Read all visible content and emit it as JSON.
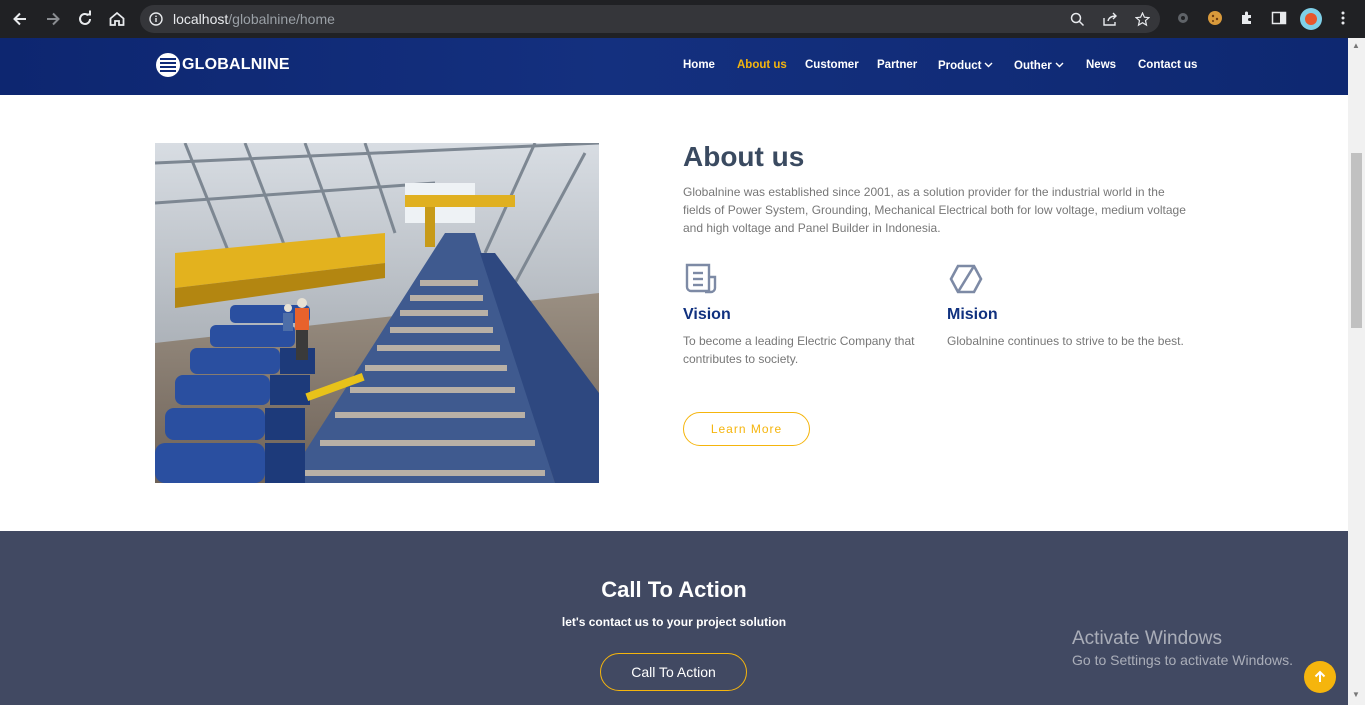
{
  "browser": {
    "url_host": "localhost",
    "url_path": "/globalnine/home"
  },
  "site": {
    "logo_text": "GLOBALNINE",
    "nav": [
      {
        "label": "Home",
        "active": false
      },
      {
        "label": "About us",
        "active": true
      },
      {
        "label": "Customer",
        "active": false
      },
      {
        "label": "Partner",
        "active": false
      },
      {
        "label": "Product",
        "dropdown": true
      },
      {
        "label": "Outher",
        "dropdown": true
      },
      {
        "label": "News",
        "active": false
      },
      {
        "label": "Contact us",
        "active": false
      }
    ],
    "accent_color": "#f5b50d",
    "header_color": "#0f2a78"
  },
  "about": {
    "title": "About us",
    "description": "Globalnine was established since 2001, as a solution provider for the industrial world in the fields of Power System, Grounding, Mechanical Electrical both for low voltage, medium voltage and high voltage and Panel Builder in Indonesia.",
    "vision": {
      "title": "Vision",
      "text": "To become a leading Electric Company that contributes to society.",
      "icon": "document-icon"
    },
    "mission": {
      "title": "Mision",
      "text": "Globalnine continues to strive to be the best.",
      "icon": "hexagon-icon"
    },
    "learn_more": "Learn More"
  },
  "cta": {
    "title": "Call To Action",
    "subtitle": "let's contact us to your project solution",
    "button": "Call To Action"
  },
  "watermark": {
    "title": "Activate Windows",
    "subtitle": "Go to Settings to activate Windows."
  }
}
